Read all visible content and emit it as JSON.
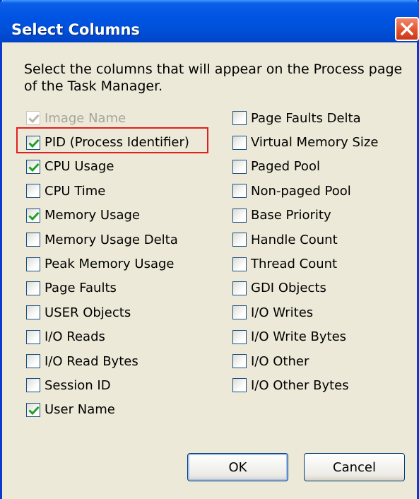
{
  "window": {
    "title": "Select Columns"
  },
  "description": "Select the columns that will appear on the Process page of the Task Manager.",
  "left_column": [
    {
      "label": "Image Name",
      "checked": true,
      "disabled": true
    },
    {
      "label": "PID (Process Identifier)",
      "checked": true,
      "disabled": false
    },
    {
      "label": "CPU Usage",
      "checked": true,
      "disabled": false
    },
    {
      "label": "CPU Time",
      "checked": false,
      "disabled": false
    },
    {
      "label": "Memory Usage",
      "checked": true,
      "disabled": false
    },
    {
      "label": "Memory Usage Delta",
      "checked": false,
      "disabled": false
    },
    {
      "label": "Peak Memory Usage",
      "checked": false,
      "disabled": false
    },
    {
      "label": "Page Faults",
      "checked": false,
      "disabled": false
    },
    {
      "label": "USER Objects",
      "checked": false,
      "disabled": false
    },
    {
      "label": "I/O Reads",
      "checked": false,
      "disabled": false
    },
    {
      "label": "I/O Read Bytes",
      "checked": false,
      "disabled": false
    },
    {
      "label": "Session ID",
      "checked": false,
      "disabled": false
    },
    {
      "label": "User Name",
      "checked": true,
      "disabled": false
    }
  ],
  "right_column": [
    {
      "label": "Page Faults Delta",
      "checked": false,
      "disabled": false
    },
    {
      "label": "Virtual Memory Size",
      "checked": false,
      "disabled": false
    },
    {
      "label": "Paged Pool",
      "checked": false,
      "disabled": false
    },
    {
      "label": "Non-paged Pool",
      "checked": false,
      "disabled": false
    },
    {
      "label": "Base Priority",
      "checked": false,
      "disabled": false
    },
    {
      "label": "Handle Count",
      "checked": false,
      "disabled": false
    },
    {
      "label": "Thread Count",
      "checked": false,
      "disabled": false
    },
    {
      "label": "GDI Objects",
      "checked": false,
      "disabled": false
    },
    {
      "label": "I/O Writes",
      "checked": false,
      "disabled": false
    },
    {
      "label": "I/O Write Bytes",
      "checked": false,
      "disabled": false
    },
    {
      "label": "I/O Other",
      "checked": false,
      "disabled": false
    },
    {
      "label": "I/O Other Bytes",
      "checked": false,
      "disabled": false
    }
  ],
  "buttons": {
    "ok": "OK",
    "cancel": "Cancel"
  },
  "colors": {
    "check": "#21a121",
    "highlight": "#e02020",
    "titlebar": "#0054e3",
    "close": "#e3512e"
  },
  "icons": {
    "close": "close-icon",
    "check": "checkmark-icon"
  }
}
